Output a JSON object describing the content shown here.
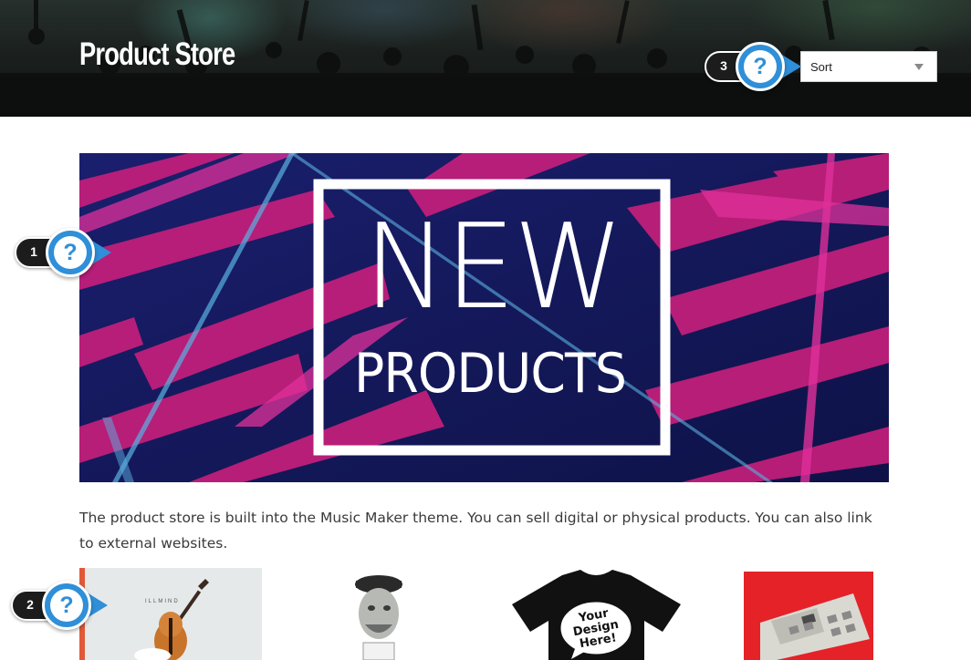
{
  "header": {
    "title": "Product Store",
    "sort": {
      "selected": "Sort"
    }
  },
  "help_hotspots": [
    {
      "number": "1",
      "glyph": "?"
    },
    {
      "number": "2",
      "glyph": "?"
    },
    {
      "number": "3",
      "glyph": "?"
    }
  ],
  "banner": {
    "line1": "NEW",
    "line2": "PRODUCTS"
  },
  "description": "The product store is built into the Music Maker theme. You can sell digital or physical products. You can also link to external websites.",
  "products": [
    {
      "image": "violin-album-cover",
      "caption": "ILLMIND"
    },
    {
      "image": "vinyl-figure"
    },
    {
      "image": "t-shirt",
      "caption": "Your Design Here!"
    },
    {
      "image": "drum-machine"
    }
  ],
  "colors": {
    "hotspot_blue": "#2f8fd8",
    "banner_navy": "#141a5c",
    "banner_pink": "#d4227e",
    "text": "#3a3a3a"
  }
}
